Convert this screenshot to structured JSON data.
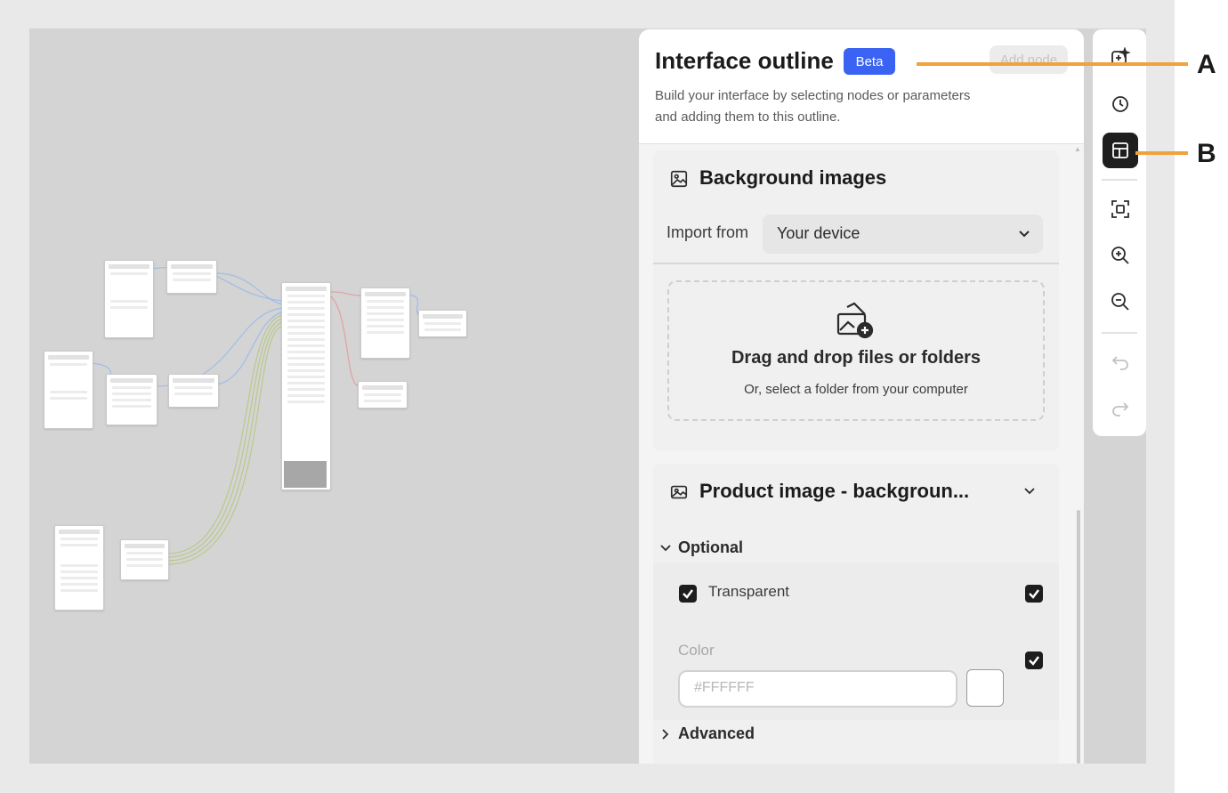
{
  "panel": {
    "title": "Interface outline",
    "badge": "Beta",
    "add_node": "Add node",
    "subtitle": "Build your interface by selecting nodes or parameters and adding them to this outline."
  },
  "background_images": {
    "title": "Background images",
    "icon": "image-icon",
    "import_label": "Import from",
    "import_value": "Your device",
    "drop_title": "Drag and drop files or folders",
    "drop_subtitle": "Or, select a folder from your computer",
    "drop_icon": "upload-image-icon"
  },
  "product_image": {
    "title": "Product image - backgroun...",
    "icon": "images-icon",
    "optional_label": "Optional",
    "transparent_label": "Transparent",
    "color_label": "Color",
    "color_placeholder": "#FFFFFF",
    "advanced_label": "Advanced"
  },
  "toolbar": {
    "items": [
      "sparkle-add-icon",
      "history-icon",
      "layout-icon",
      "fit-screen-icon",
      "zoom-in-icon",
      "zoom-out-icon",
      "undo-icon",
      "redo-icon"
    ],
    "active": "layout-icon"
  },
  "callouts": {
    "a": "A",
    "b": "B"
  },
  "colors": {
    "accent": "#3b63f3",
    "callout_line": "#f0a23c",
    "active_button": "#1e1e1e"
  }
}
